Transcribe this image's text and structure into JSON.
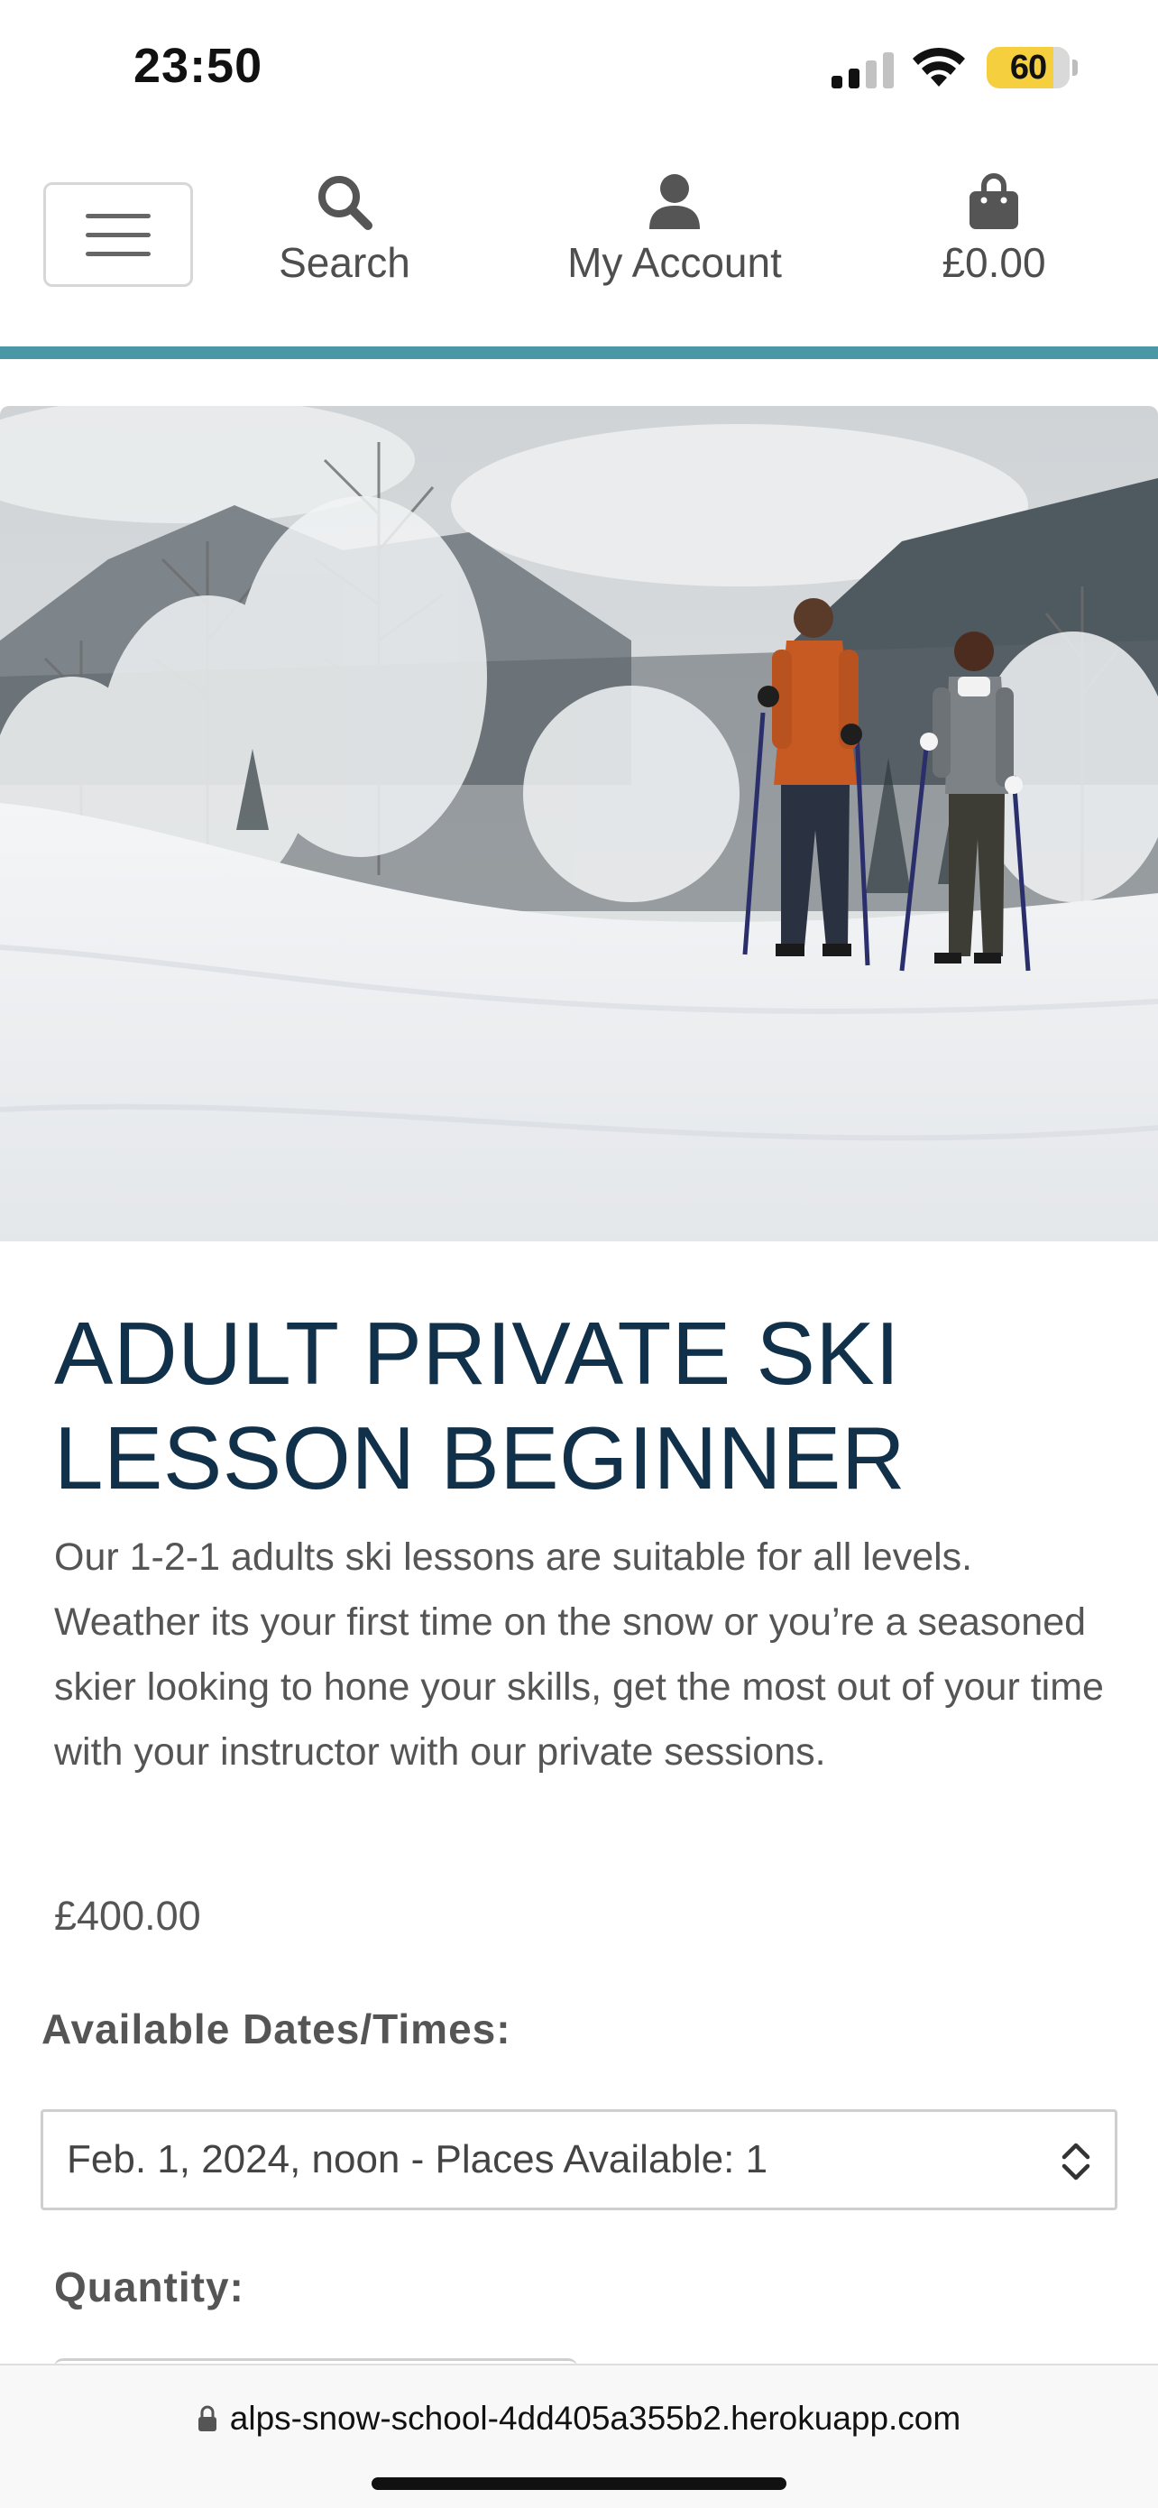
{
  "status_bar": {
    "time": "23:50",
    "battery": "60",
    "icons": [
      "cellular-signal-icon",
      "wifi-icon",
      "battery-icon"
    ],
    "battery_color": "#f5cf3d"
  },
  "nav": {
    "search_label": "Search",
    "account_label": "My Account",
    "bag_total": "£0.00",
    "icons": [
      "hamburger-menu-icon",
      "search-icon",
      "user-icon",
      "shopping-bag-icon"
    ],
    "accent_color": "#4a97a6"
  },
  "product": {
    "title_line1": "ADULT PRIVATE SKI",
    "title_line2": "LESSON BEGINNER",
    "description": "Our 1-2-1 adults ski lessons are suitable for all levels. Weather its your first time on the snow or you’re a seasoned skier looking to hone your skills, get the most out of your time with your instructor with our private sessions.",
    "price": "£400.00",
    "dates_label": "Available Dates/Times:",
    "selected_date": "Feb. 1, 2024, noon - Places Available: 1",
    "quantity_label": "Quantity:",
    "title_color": "#11304a"
  },
  "browser": {
    "url": "alps-snow-school-4dd405a355b2.herokuapp.com",
    "icons": [
      "lock-icon"
    ]
  }
}
